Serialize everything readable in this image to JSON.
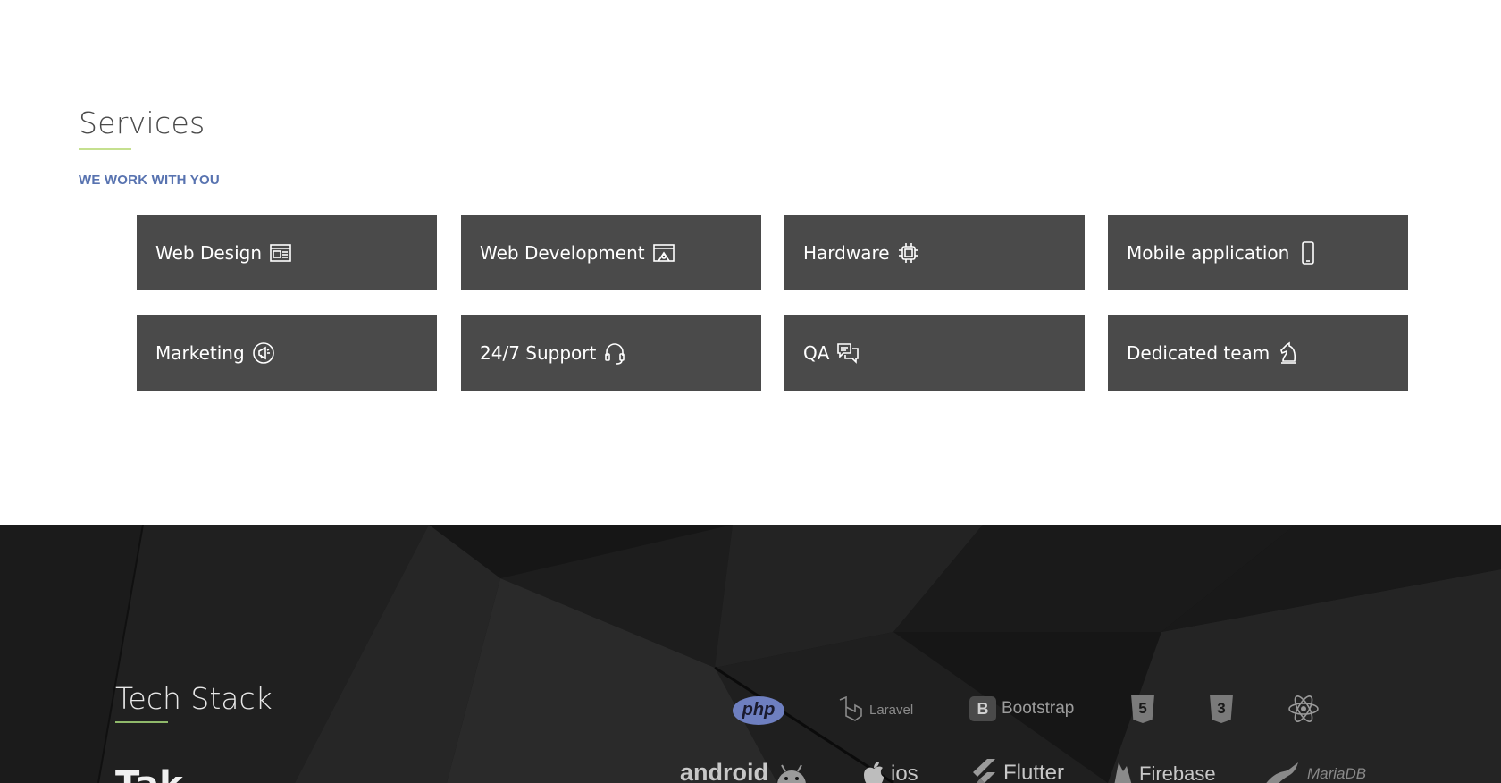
{
  "services": {
    "title": "Services",
    "subtitle": "WE WORK WITH YOU",
    "cards": [
      {
        "label": "Web Design",
        "icon": "web-design-icon"
      },
      {
        "label": "Web Development",
        "icon": "web-development-icon"
      },
      {
        "label": "Hardware",
        "icon": "chip-icon"
      },
      {
        "label": "Mobile application",
        "icon": "mobile-phone-icon"
      },
      {
        "label": "Marketing",
        "icon": "marketing-icon"
      },
      {
        "label": "24/7 Support",
        "icon": "headset-icon"
      },
      {
        "label": "QA",
        "icon": "chat-bubbles-icon"
      },
      {
        "label": "Dedicated team",
        "icon": "chess-knight-icon"
      }
    ]
  },
  "tech_stack": {
    "title": "Tech Stack",
    "heading": "Tak",
    "logos": [
      {
        "name": "php",
        "text": "php"
      },
      {
        "name": "laravel",
        "text": "Laravel"
      },
      {
        "name": "bootstrap",
        "text": "Bootstrap"
      },
      {
        "name": "html5",
        "text": "5"
      },
      {
        "name": "css3",
        "text": "3"
      },
      {
        "name": "react",
        "text": ""
      },
      {
        "name": "android",
        "text": "android"
      },
      {
        "name": "ios",
        "text": "ios"
      },
      {
        "name": "flutter",
        "text": "Flutter"
      },
      {
        "name": "firebase",
        "text": "Firebase"
      },
      {
        "name": "mariadb",
        "text": "MariaDB"
      }
    ]
  },
  "colors": {
    "card_bg": "#4a4a4a",
    "subtitle": "#5873b0",
    "accent_underline": "#c5e08f",
    "tech_bg": "#141414",
    "php_badge": "#6e7fc0"
  }
}
